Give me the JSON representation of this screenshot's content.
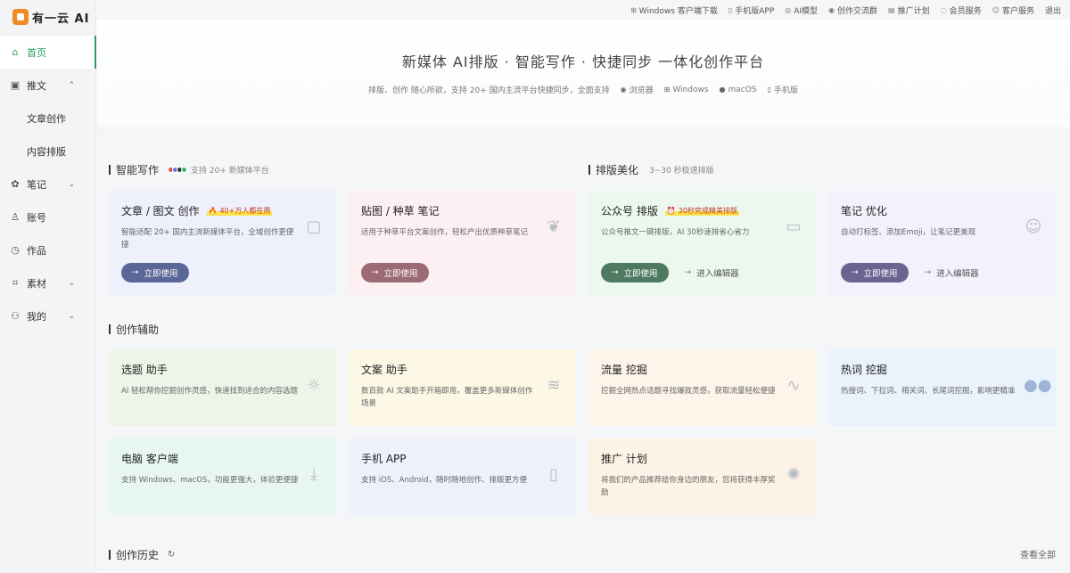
{
  "logo": {
    "text": "有一云 AI"
  },
  "sidebar": {
    "items": [
      {
        "label": "首页",
        "icon": "home-icon",
        "glyph": "⌂"
      },
      {
        "label": "推文",
        "icon": "article-icon",
        "glyph": "▣",
        "chevron": "⌃"
      },
      {
        "label": "文章创作"
      },
      {
        "label": "内容排版"
      },
      {
        "label": "笔记",
        "icon": "note-icon",
        "glyph": "✿",
        "chevron": "⌄"
      },
      {
        "label": "账号",
        "icon": "account-icon",
        "glyph": "♙"
      },
      {
        "label": "作品",
        "icon": "works-icon",
        "glyph": "◷"
      },
      {
        "label": "素材",
        "icon": "material-icon",
        "glyph": "⌗",
        "chevron": "⌄"
      },
      {
        "label": "我的",
        "icon": "user-icon",
        "glyph": "⚇",
        "chevron": "⌄"
      }
    ]
  },
  "topbar": {
    "links": [
      {
        "label": "Windows 客户端下载",
        "glyph": "⊞"
      },
      {
        "label": "手机版APP",
        "glyph": "▯"
      },
      {
        "label": "AI模型",
        "glyph": "◎"
      },
      {
        "label": "创作交流群",
        "glyph": "◉"
      },
      {
        "label": "推广计划",
        "glyph": "▤"
      },
      {
        "label": "会员服务",
        "glyph": "◌"
      },
      {
        "label": "客户服务",
        "glyph": "☺"
      },
      {
        "label": "退出",
        "glyph": ""
      }
    ]
  },
  "hero": {
    "title": "新媒体 AI排版 · 智能写作 · 快捷同步 一体化创作平台",
    "subtitle": "排版、创作 随心所欲，支持 20+ 国内主流平台快捷同步，全面支持",
    "platforms": [
      {
        "label": "浏览器",
        "glyph": "◉"
      },
      {
        "label": "Windows",
        "glyph": "⊞"
      },
      {
        "label": "macOS",
        "glyph": ""
      },
      {
        "label": "手机版",
        "glyph": "▯"
      }
    ]
  },
  "sections": {
    "writing": {
      "title": "智能写作",
      "note": "支持 20+ 新媒体平台"
    },
    "layout": {
      "title": "排版美化",
      "note": "3~30 秒极速排版"
    },
    "assist": {
      "title": "创作辅助"
    },
    "history": {
      "title": "创作历史",
      "more": "查看全部"
    }
  },
  "cards": {
    "article": {
      "title": "文章 / 图文 创作",
      "badge": "40+万人都在用",
      "badge_glyph": "🔥",
      "desc": "智能适配 20+ 国内主流新媒体平台，全域创作更便捷",
      "btn": "立即使用",
      "color": "#5b6796",
      "bg": "#eef0fb"
    },
    "note": {
      "title": "贴图 / 种草 笔记",
      "desc": "适用于种草平台文案创作，轻松产出优质种草笔记",
      "btn": "立即使用",
      "color": "#9c6a76",
      "bg": "#fdf0f3"
    },
    "wechat": {
      "title": "公众号 排版",
      "badge": "30秒完成精美排版",
      "badge_glyph": "⏰",
      "desc": "公众号推文一键排版，AI 30秒速排省心省力",
      "btn": "立即使用",
      "link": "进入编辑器",
      "color": "#4f7a62",
      "bg": "#ecf8ef"
    },
    "optimize": {
      "title": "笔记 优化",
      "desc": "自动打标签、添加Emoji，让笔记更美观",
      "btn": "立即使用",
      "link": "进入编辑器",
      "color": "#6c6391",
      "bg": "#f3f1fb"
    },
    "topic": {
      "title": "选题 助手",
      "desc": "AI 轻松帮你挖掘创作灵感，快速找到适合的内容选题",
      "bg": "#eef4e8"
    },
    "copy": {
      "title": "文案 助手",
      "desc": "数百款 AI 文案助手开箱即用，覆盖更多新媒体创作场景",
      "bg": "#fdf7e6"
    },
    "traffic": {
      "title": "流量 挖掘",
      "desc": "挖掘全网热点话题寻找爆款灵感，获取流量轻松便捷",
      "bg": "#fdf4ea"
    },
    "hotword": {
      "title": "热词 挖掘",
      "desc": "热搜词、下拉词、相关词、长尾词挖掘，影响更精准",
      "bg": "#eaf2fb"
    },
    "desktop": {
      "title": "电脑 客户端",
      "desc": "支持 Windows、macOS，功能更强大，体验更便捷",
      "bg": "#e8f6f0"
    },
    "mobile": {
      "title": "手机 APP",
      "desc": "支持 iOS、Android，随时随地创作、排版更方便",
      "bg": "#eef0fb"
    },
    "promo": {
      "title": "推广 计划",
      "desc": "将我们的产品推荐给你身边的朋友，您将获得丰厚奖励",
      "bg": "#fdf2e6"
    }
  }
}
